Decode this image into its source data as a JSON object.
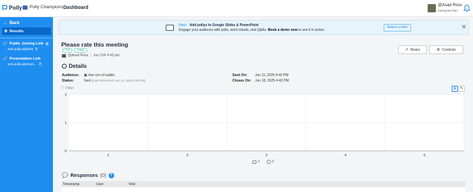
{
  "app": {
    "brand": "Polly",
    "workspace": "Polly Champions",
    "nav_dashboard": "Dashboard"
  },
  "user": {
    "name": "@Asad Ross",
    "plan": "Enterprise Plan"
  },
  "sidebar": {
    "back": "Back",
    "results": "Results",
    "public_link_title": "Public Joining Link",
    "public_link_url": "web.polly.ai/jdl493",
    "presentation_link_title": "Presentation Link",
    "presentation_link_url": "web.polly.ai/presen..."
  },
  "banner": {
    "new_label": "New!",
    "headline": "Add pollys to Google Slides & PowerPoint",
    "body_prefix": "Engage your audience with polls, word clouds, and Q&As.",
    "body_cta": "Book a demo now",
    "body_suffix": "to see it in action.",
    "button": "Select a time",
    "accent": "#1f8ef1"
  },
  "poll": {
    "title": "Please rate this meeting",
    "badges": [
      "Poll",
      "Public"
    ],
    "author": "@Asad Ross",
    "created": "Jun 11th 4:42 pm"
  },
  "actions": {
    "share": "Share",
    "controls": "Controls"
  },
  "details": {
    "heading": "Details",
    "audience_label": "Audience:",
    "audience_value": "#arr-cm-v2-public",
    "status_label": "Status:",
    "status_value": "Sent",
    "status_sub": "(Last Refreshed: Jun 11, 2025 4:50 PM)",
    "sent_on_label": "Sent On:",
    "sent_on_value": "Jun 11, 2025 4:42 PM",
    "closes_on_label": "Closes On:",
    "closes_on_value": "Jun 18, 2025 4:42 PM"
  },
  "filter_label": "Filter",
  "legend": {
    "first_count": "0",
    "second_count": "0"
  },
  "responses": {
    "heading": "Responses",
    "count": "(0)",
    "columns": [
      "Timestamp",
      "User",
      "Vote"
    ]
  },
  "chart_data": {
    "type": "bar",
    "categories": [
      "1",
      "2",
      "3",
      "4",
      "5"
    ],
    "values": [
      0,
      0,
      0,
      0,
      0
    ],
    "ylim": [
      0,
      2
    ],
    "yticks": [
      "0",
      "1",
      "2"
    ],
    "grid": true
  }
}
